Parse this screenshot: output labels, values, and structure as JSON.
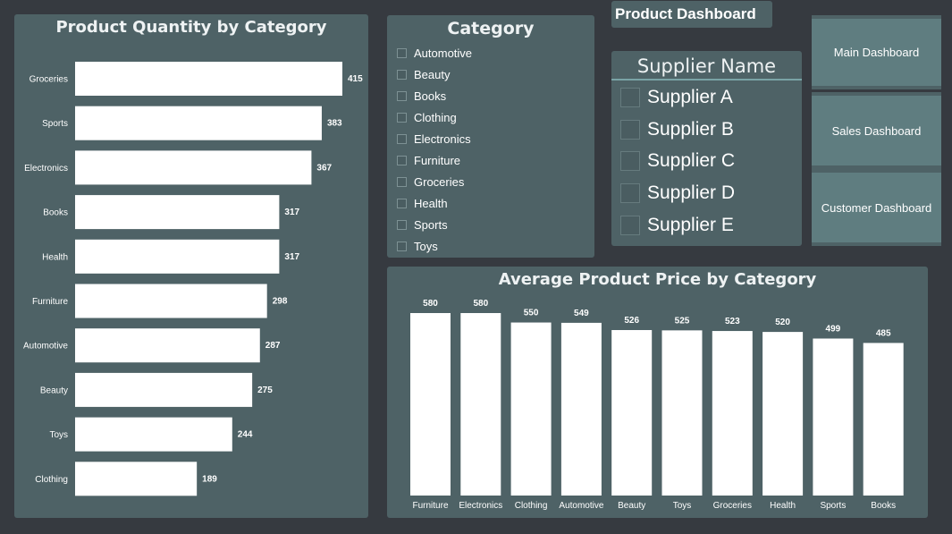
{
  "page": {
    "title": "Product Dashboard"
  },
  "navigation": {
    "buttons": [
      "Main Dashboard",
      "Sales Dashboard",
      "Customer Dashboard"
    ]
  },
  "category_slicer": {
    "title": "Category",
    "items": [
      "Automotive",
      "Beauty",
      "Books",
      "Clothing",
      "Electronics",
      "Furniture",
      "Groceries",
      "Health",
      "Sports",
      "Toys"
    ]
  },
  "supplier_slicer": {
    "title": "Supplier Name",
    "items": [
      "Supplier A",
      "Supplier B",
      "Supplier C",
      "Supplier D",
      "Supplier E"
    ]
  },
  "colors": {
    "background": "#363a40",
    "panel": "#4e6266",
    "bar": "#ffffff",
    "button": "#5f7d80"
  },
  "chart_data": [
    {
      "type": "bar",
      "orientation": "horizontal",
      "title": "Product Quantity by Category",
      "categories": [
        "Groceries",
        "Sports",
        "Electronics",
        "Books",
        "Health",
        "Furniture",
        "Automotive",
        "Beauty",
        "Toys",
        "Clothing"
      ],
      "values": [
        415,
        383,
        367,
        317,
        317,
        298,
        287,
        275,
        244,
        189
      ],
      "xlabel": "",
      "ylabel": "",
      "data_labels": true,
      "grid": false
    },
    {
      "type": "bar",
      "orientation": "vertical",
      "title": "Average Product Price by Category",
      "categories": [
        "Furniture",
        "Electronics",
        "Clothing",
        "Automotive",
        "Beauty",
        "Toys",
        "Groceries",
        "Health",
        "Sports",
        "Books"
      ],
      "values": [
        580,
        580,
        550,
        549,
        526,
        525,
        523,
        520,
        499,
        485
      ],
      "xlabel": "",
      "ylabel": "",
      "data_labels": true,
      "grid": false
    }
  ]
}
